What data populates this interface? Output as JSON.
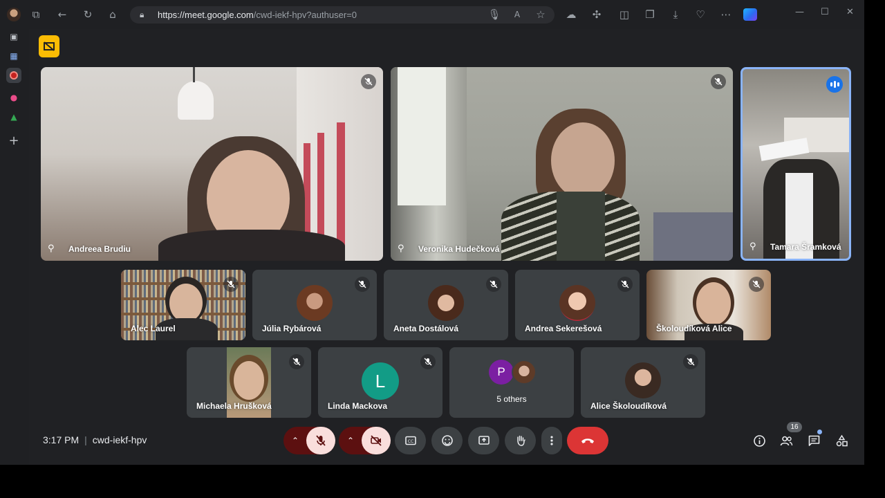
{
  "browser": {
    "url_host": "https://meet.google.com",
    "url_path": "/cwd-iekf-hpv?authuser=0"
  },
  "tiles_large": [
    {
      "name": "Andreea Brudiu",
      "muted": true
    },
    {
      "name": "Veronika Hudečková",
      "muted": true
    },
    {
      "name": "Tamara Šramková",
      "speaking": true
    }
  ],
  "tiles_row2": [
    {
      "name": "Alec Laurel"
    },
    {
      "name": "Júlia Rybárová"
    },
    {
      "name": "Aneta Dostálová"
    },
    {
      "name": "Andrea Sekerešová"
    },
    {
      "name": "Školoudíková Alice"
    }
  ],
  "tiles_row3": [
    {
      "name": "Michaela Hrušková"
    },
    {
      "name": "Linda Mackova",
      "initial": "L"
    },
    {
      "name": "5 others",
      "initial": "P"
    },
    {
      "name": "Alice Školoudíková"
    }
  ],
  "bottom": {
    "time": "3:17 PM",
    "separator": "|",
    "meeting_code": "cwd-iekf-hpv",
    "participants_count": "16"
  },
  "colors": {
    "background": "#202124",
    "tile": "#3c4043",
    "end_call": "#dc3535",
    "muted_pill": "#f9dedc",
    "speaking": "#1a73e8",
    "host_badge": "#fbbc04"
  }
}
